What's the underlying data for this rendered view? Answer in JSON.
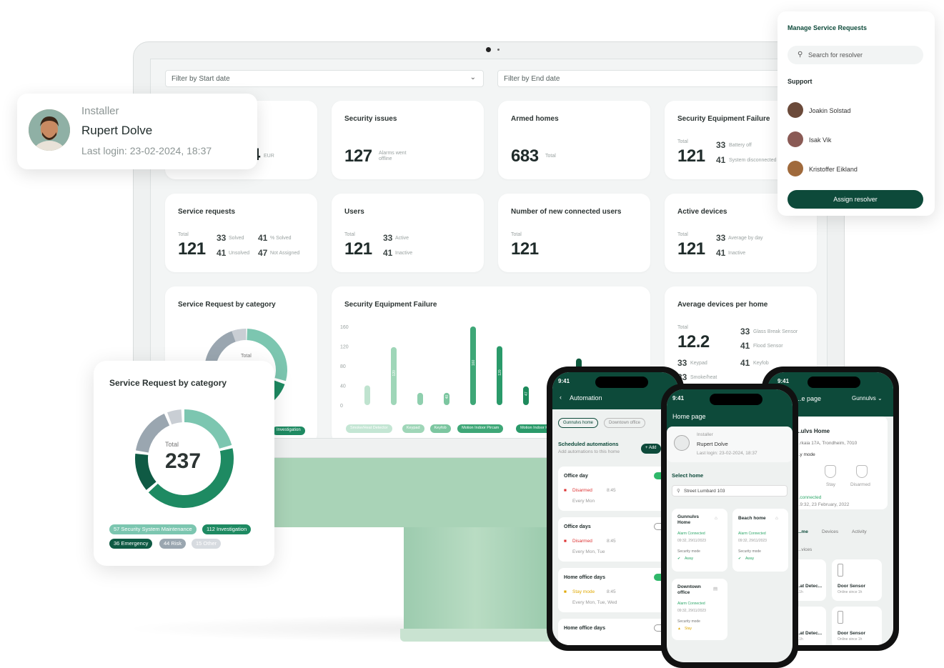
{
  "dashboard": {
    "filter_start": "Filter by Start date",
    "filter_end": "Filter by End date",
    "cards": {
      "revenue": {
        "value_tail": "4",
        "unit": "EUR"
      },
      "security_issues": {
        "title": "Security issues",
        "value": "127",
        "sub": "Alarms went offline"
      },
      "armed_homes": {
        "title": "Armed homes",
        "value": "683",
        "sub": "Total"
      },
      "equipment_failure": {
        "title": "Security Equipment Failure",
        "total_label": "Total",
        "value": "121",
        "a_val": "33",
        "a_label": "Battery off",
        "b_val": "41",
        "b_label": "System disconnected"
      },
      "service_requests": {
        "title": "Service requests",
        "total_label": "Total",
        "value": "121",
        "a_val": "33",
        "a_label": "Solved",
        "b_val": "41",
        "b_label": "Unsolved",
        "c_val": "41",
        "c_label": "% Solved",
        "d_val": "47",
        "d_label": "Not Assigned"
      },
      "users": {
        "title": "Users",
        "total_label": "Total",
        "value": "121",
        "a_val": "33",
        "a_label": "Active",
        "b_val": "41",
        "b_label": "Inactive"
      },
      "new_users": {
        "title": "Number of new connected users",
        "total_label": "Total",
        "value": "121"
      },
      "active_devices": {
        "title": "Active devices",
        "total_label": "Total",
        "value": "121",
        "a_val": "33",
        "a_label": "Average by day",
        "b_val": "41",
        "b_label": "Inactive"
      },
      "sr_by_category": {
        "title": "Service Request by category",
        "center": "Total",
        "tag": "Investigation"
      },
      "failure_chart": {
        "title": "Security Equipment Failure",
        "tags": [
          "Smoke/Heat Detector",
          "Keypad",
          "Keyfob",
          "Motion Indoor Pircam",
          "Motion Indoor PIR"
        ]
      },
      "avg_devices": {
        "title": "Average devices per home",
        "total_label": "Total",
        "value": "12.2",
        "rows": [
          {
            "val": "33",
            "label": "Glass Break Sensor"
          },
          {
            "val": "41",
            "label": "Flood Sensor"
          },
          {
            "val": "33",
            "label": "Keypad"
          },
          {
            "val": "41",
            "label": "Keyfob"
          },
          {
            "val": "33",
            "label": "Smoke/heat"
          }
        ]
      }
    }
  },
  "chart_data": {
    "type": "bar",
    "title": "Security Equipment Failure",
    "yticks": [
      0,
      40,
      80,
      120,
      160
    ],
    "ylim": [
      0,
      160
    ],
    "values": [
      40,
      118,
      25,
      25,
      160,
      120,
      38,
      60,
      95
    ],
    "labels": [
      "",
      "120",
      "",
      "40",
      "160",
      "120",
      "47",
      "83",
      ""
    ],
    "colors": [
      "#bfe3cf",
      "#9fd6b8",
      "#8fcfae",
      "#7cc6a0",
      "#3ea777",
      "#2a9a6a",
      "#1e8a5c",
      "#167a50",
      "#0f5a3e"
    ]
  },
  "installer": {
    "role": "Installer",
    "name": "Rupert Dolve",
    "last_login": "Last login: 23-02-2024, 18:37"
  },
  "manage": {
    "title": "Manage Service Requests",
    "search_placeholder": "Search for resolver",
    "section": "Support",
    "people": [
      "Joakin Solstad",
      "Isak Vik",
      "Kristoffer Eikland"
    ],
    "assign": "Assign resolver"
  },
  "donut": {
    "title": "Service Request by category",
    "center_label": "Total",
    "center_value": "237",
    "segments": [
      {
        "value": 57,
        "label": "Security System Maintenance",
        "color": "#7cc6b0"
      },
      {
        "value": 112,
        "label": "Investigation",
        "color": "#1e8a62"
      },
      {
        "value": 36,
        "label": "Emergency",
        "color": "#0f5a44"
      },
      {
        "value": 44,
        "label": "Risk",
        "color": "#9aa6b0"
      },
      {
        "value": 15,
        "label": "Other",
        "color": "#c9ced4"
      }
    ],
    "pills": [
      "57 Security System Maintenance",
      "112 Investigation",
      "36 Emergency",
      "44 Risk",
      "15 Other"
    ]
  },
  "phone_left": {
    "time": "9:41",
    "header": "Automation",
    "chips": [
      "Gunnulvs home",
      "Downtown office"
    ],
    "section_title": "Scheduled automations",
    "section_sub": "Add automations to this home",
    "add": "+ Add",
    "items": [
      {
        "title": "Office day",
        "status": "Disarmed",
        "time": "8:45",
        "days": "Every Mon",
        "on": true
      },
      {
        "title": "Office days",
        "status": "Disarmed",
        "time": "8:45",
        "days": "Every Mon, Tue",
        "on": false
      },
      {
        "title": "Home office days",
        "status": "Stay mode",
        "time": "8:45",
        "days": "Every Mon, Tue, Wed",
        "on": true
      },
      {
        "title": "Home office days",
        "status": "",
        "time": "",
        "days": "",
        "on": false
      }
    ]
  },
  "phone_mid": {
    "time": "9:41",
    "header": "Home page",
    "role": "Installer",
    "name": "Rupert Dolve",
    "login": "Last login: 23-02-2024, 18:37",
    "select": "Select home",
    "search": "Street Lumbard 103",
    "homes": [
      {
        "name": "Gunnulvs Home",
        "status": "Alarm Connected",
        "date": "09:32, 29/11/2023",
        "mode_label": "Security mode",
        "mode": "Away"
      },
      {
        "name": "Beach home",
        "status": "Alarm Connected",
        "date": "09:32, 29/11/2023",
        "mode_label": "Security mode",
        "mode": "Away"
      },
      {
        "name": "Downtown office",
        "status": "Alarm Connected",
        "date": "09:32, 29/11/2023",
        "mode_label": "Security mode",
        "mode": "Stay"
      }
    ]
  },
  "phone_right": {
    "time": "9:41",
    "header": "...e page",
    "home_select": "Gunnulvs",
    "home_name": "...ulvs Home",
    "address": "...rkaia 17A, Trondheim, 7010",
    "mode_label": "...y mode",
    "modes": [
      "Stay",
      "Disarmed"
    ],
    "connected": "...connected",
    "date": "...9:32, 23 February, 2022",
    "tabs": [
      "...me",
      "Devices",
      "Activity"
    ],
    "devices_label": "...vices",
    "devices": [
      {
        "name": "...at Detec...",
        "sub": "...1h"
      },
      {
        "name": "Door Sensor",
        "sub": "Online since 1h"
      },
      {
        "name": "...at Detec...",
        "sub": "...1h"
      },
      {
        "name": "Door Sensor",
        "sub": "Online since 1h"
      }
    ]
  }
}
